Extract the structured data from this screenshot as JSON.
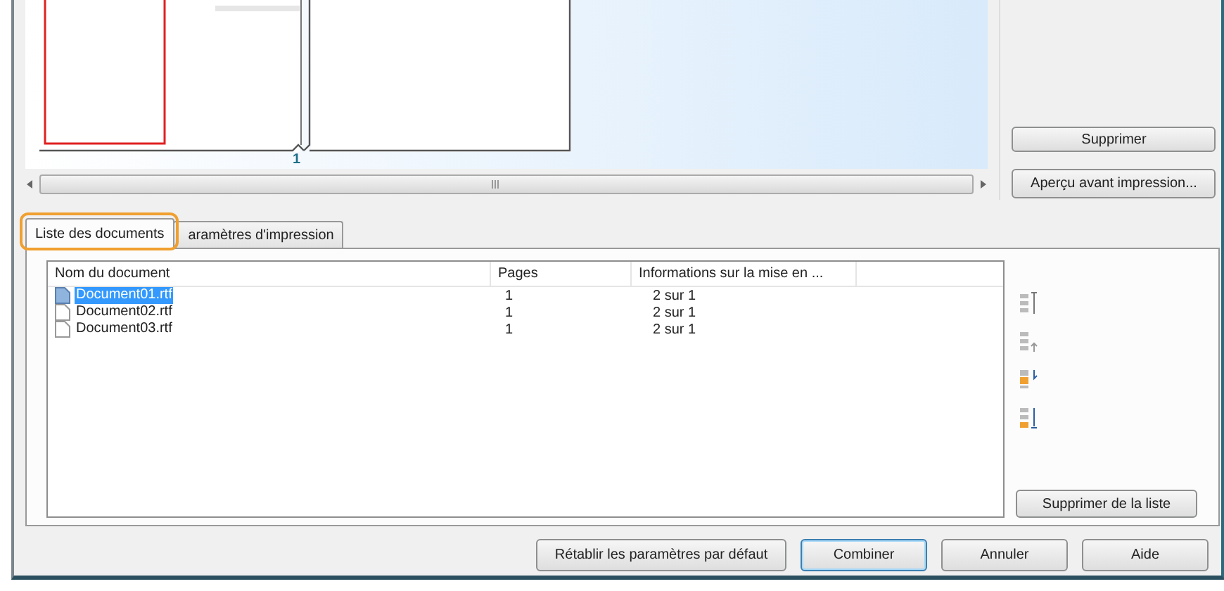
{
  "preview": {
    "page_number": "1"
  },
  "side_buttons": [
    "Supprimer",
    "Aperçu avant impression..."
  ],
  "tabs": [
    {
      "label": "Liste des documents",
      "selected": true,
      "highlighted": true
    },
    {
      "label": "aramètres d'impression",
      "selected": false,
      "highlighted": false
    }
  ],
  "table": {
    "columns": [
      "Nom du document",
      "Pages",
      "Informations sur la mise en ..."
    ],
    "rows": [
      {
        "name": "Document01.rtf",
        "pages": "1",
        "layout": "2 sur 1",
        "selected": true
      },
      {
        "name": "Document02.rtf",
        "pages": "1",
        "layout": "2 sur 1",
        "selected": false
      },
      {
        "name": "Document03.rtf",
        "pages": "1",
        "layout": "2 sur 1",
        "selected": false
      }
    ]
  },
  "list_actions": {
    "remove_button": "Supprimer de la liste"
  },
  "buttons": [
    {
      "label": "Rétablir les paramètres par défaut",
      "default": false
    },
    {
      "label": "Combiner",
      "default": true
    },
    {
      "label": "Annuler",
      "default": false
    },
    {
      "label": "Aide",
      "default": false
    }
  ]
}
